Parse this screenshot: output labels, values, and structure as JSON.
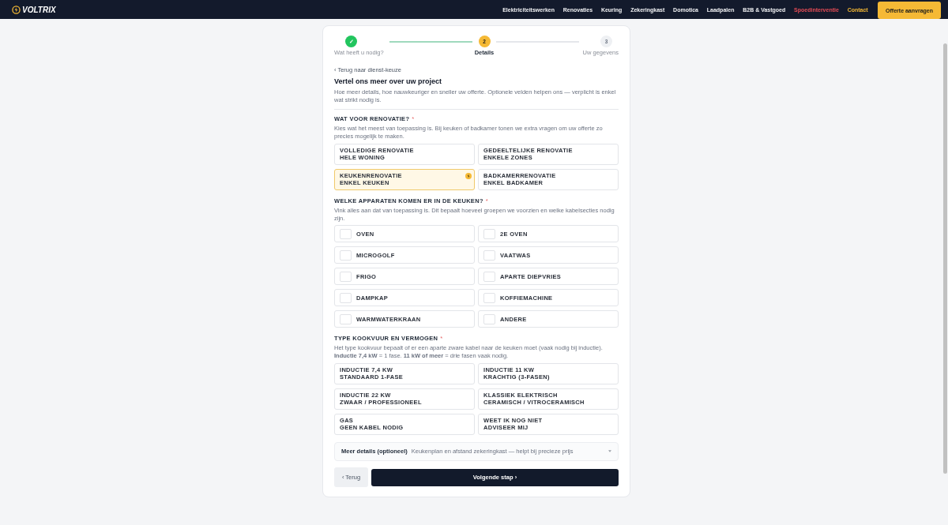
{
  "brand": {
    "name": "VOLTRIX"
  },
  "nav": [
    {
      "label": "Elektriciteitswerken",
      "kind": "normal"
    },
    {
      "label": "Renovaties",
      "kind": "normal"
    },
    {
      "label": "Keuring",
      "kind": "normal"
    },
    {
      "label": "Zekeringkast",
      "kind": "normal"
    },
    {
      "label": "Domotica",
      "kind": "normal"
    },
    {
      "label": "Laadpalen",
      "kind": "normal"
    },
    {
      "label": "B2B & Vastgoed",
      "kind": "normal"
    },
    {
      "label": "Spoedinterventie",
      "kind": "urgent"
    },
    {
      "label": "Contact",
      "kind": "accent"
    }
  ],
  "cta": "Offerte aanvragen",
  "steps": [
    {
      "marker": "✓",
      "label": "Wat heeft u nodig?",
      "completed": true,
      "selected": false
    },
    {
      "marker": "2",
      "label": "Details",
      "completed": false,
      "selected": true
    },
    {
      "marker": "3",
      "label": "Uw gegevens",
      "completed": false,
      "selected": false
    }
  ],
  "back_link": "‹ Terug naar dienst-keuze",
  "title": "Vertel ons meer over uw project",
  "intro": "Hoe meer details, hoe nauwkeuriger en sneller uw offerte. Optionele velden helpen ons — verplicht is enkel wat strikt nodig is.",
  "sections": [
    {
      "kind": "choice",
      "label": "WAT VOOR RENOVATIE?",
      "required_mark": "*",
      "hint": "Kies wat het meest van toepassing is. Bij keuken of badkamer tonen we extra vragen om uw offerte zo precies mogelijk te maken.",
      "options": [
        {
          "title": "VOLLEDIGE RENOVATIE",
          "subtitle": "HELE WONING",
          "selected": false
        },
        {
          "title": "GEDEELTELIJKE RENOVATIE",
          "subtitle": "ENKELE ZONES",
          "selected": false
        },
        {
          "title": "KEUKENRENOVATIE",
          "subtitle": "ENKEL KEUKEN",
          "selected": true
        },
        {
          "title": "BADKAMERRENOVATIE",
          "subtitle": "ENKEL BADKAMER",
          "selected": false
        }
      ]
    },
    {
      "kind": "checkboxes",
      "label": "WELKE APPARATEN KOMEN ER IN DE KEUKEN?",
      "required_mark": "*",
      "hint": "Vink alles aan dat van toepassing is. Dit bepaalt hoeveel groepen we voorzien en welke kabelsecties nodig zijn.",
      "options": [
        {
          "title": "OVEN",
          "checked": false
        },
        {
          "title": "2E OVEN",
          "checked": false
        },
        {
          "title": "MICROGOLF",
          "checked": false
        },
        {
          "title": "VAATWAS",
          "checked": false
        },
        {
          "title": "FRIGO",
          "checked": false
        },
        {
          "title": "APARTE DIEPVRIES",
          "checked": false
        },
        {
          "title": "DAMPKAP",
          "checked": false
        },
        {
          "title": "KOFFIEMACHINE",
          "checked": false
        },
        {
          "title": "WARMWATERKRAAN",
          "checked": false
        },
        {
          "title": "ANDERE",
          "checked": false
        }
      ]
    },
    {
      "kind": "choice",
      "label": "TYPE KOOKVUUR EN VERMOGEN",
      "required_mark": "*",
      "hint": "Het type kookvuur bepaalt of er een aparte zware kabel naar de keuken moet (vaak nodig bij inductie). **Inductie 7,4 kW** = 1 fase. **11 kW of meer** = drie fasen vaak nodig.",
      "options": [
        {
          "title": "INDUCTIE 7,4 KW",
          "subtitle": "STANDAARD 1-FASE",
          "selected": false
        },
        {
          "title": "INDUCTIE 11 KW",
          "subtitle": "KRACHTIG (3-FASEN)",
          "selected": false
        },
        {
          "title": "INDUCTIE 22 KW",
          "subtitle": "ZWAAR / PROFESSIONEEL",
          "selected": false
        },
        {
          "title": "KLASSIEK ELEKTRISCH",
          "subtitle": "CERAMISCH / VITROCERAMISCH",
          "selected": false
        },
        {
          "title": "GAS",
          "subtitle": "GEEN KABEL NODIG",
          "selected": false
        },
        {
          "title": "WEET IK NOG NIET",
          "subtitle": "ADVISEER MIJ",
          "selected": false
        }
      ]
    }
  ],
  "more_details": {
    "title": "Meer details (optioneel)",
    "hint": "Keukenplan en afstand zekeringkast — helpt bij precieze prijs",
    "expanded": false
  },
  "buttons": {
    "back": "‹ Terug",
    "next": "Volgende stap ›"
  }
}
